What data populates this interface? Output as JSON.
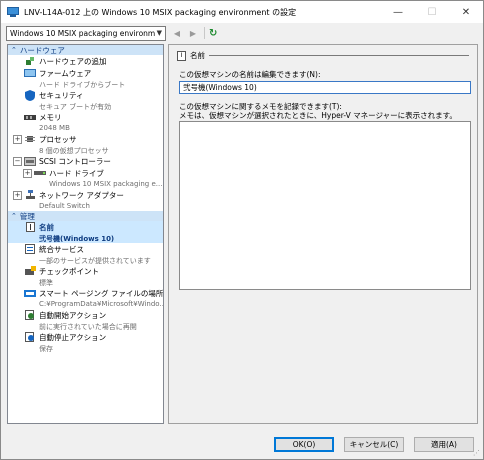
{
  "window": {
    "title": "LNV-L14A-012 上の Windows 10 MSIX packaging environment の設定",
    "minimize": "—",
    "maximize": "☐",
    "close": "✕"
  },
  "toolbar": {
    "vm_selector": "Windows 10 MSIX packaging environm",
    "back": "◀",
    "forward": "▶",
    "refresh": "↻"
  },
  "left": {
    "hardware_header": "ハードウェア",
    "hardware": [
      {
        "label": "ハードウェアの追加",
        "sub": "",
        "icon": "add-hardware-icon"
      },
      {
        "label": "ファームウェア",
        "sub": "ハード ドライブからブート",
        "icon": "firmware-icon"
      },
      {
        "label": "セキュリティ",
        "sub": "セキュア ブートが有効",
        "icon": "security-shield-icon"
      },
      {
        "label": "メモリ",
        "sub": "2048 MB",
        "icon": "memory-icon"
      },
      {
        "label": "プロセッサ",
        "sub": "8 個の仮想プロセッサ",
        "icon": "processor-icon",
        "expander": "+"
      },
      {
        "label": "SCSI コントローラー",
        "sub": "",
        "icon": "scsi-controller-icon",
        "expander": "−"
      },
      {
        "label": "ハード ドライブ",
        "sub": "Windows 10 MSIX packaging e...",
        "icon": "hard-drive-icon",
        "expander": "+"
      },
      {
        "label": "ネットワーク アダプター",
        "sub": "Default Switch",
        "icon": "network-adapter-icon",
        "expander": "+"
      }
    ],
    "management_header": "管理",
    "management": [
      {
        "label": "名前",
        "sub": "弐号機(Windows 10)",
        "icon": "name-icon",
        "selected": true
      },
      {
        "label": "統合サービス",
        "sub": "一部のサービスが提供されています",
        "icon": "integration-services-icon"
      },
      {
        "label": "チェックポイント",
        "sub": "標準",
        "icon": "checkpoint-icon"
      },
      {
        "label": "スマート ページング ファイルの場所",
        "sub": "C:¥ProgramData¥Microsoft¥Windo...",
        "icon": "smart-paging-icon"
      },
      {
        "label": "自動開始アクション",
        "sub": "前に実行されていた場合に再開",
        "icon": "auto-start-icon"
      },
      {
        "label": "自動停止アクション",
        "sub": "保存",
        "icon": "auto-stop-icon"
      }
    ]
  },
  "right": {
    "section_title": "名前",
    "name_label": "この仮想マシンの名前は編集できます(N):",
    "name_value": "弐号機(Windows 10)",
    "notes_label": "この仮想マシンに関するメモを記録できます(T):",
    "notes_hint": "メモは、仮想マシンが選択されたときに、Hyper-V マネージャーに表示されます。",
    "notes_value": ""
  },
  "buttons": {
    "ok": "OK(O)",
    "cancel": "キャンセル(C)",
    "apply": "適用(A)"
  },
  "colors": {
    "section_header_bg": "#cde3f7",
    "selection_bg": "#cce8ff",
    "accent": "#0078d7"
  }
}
